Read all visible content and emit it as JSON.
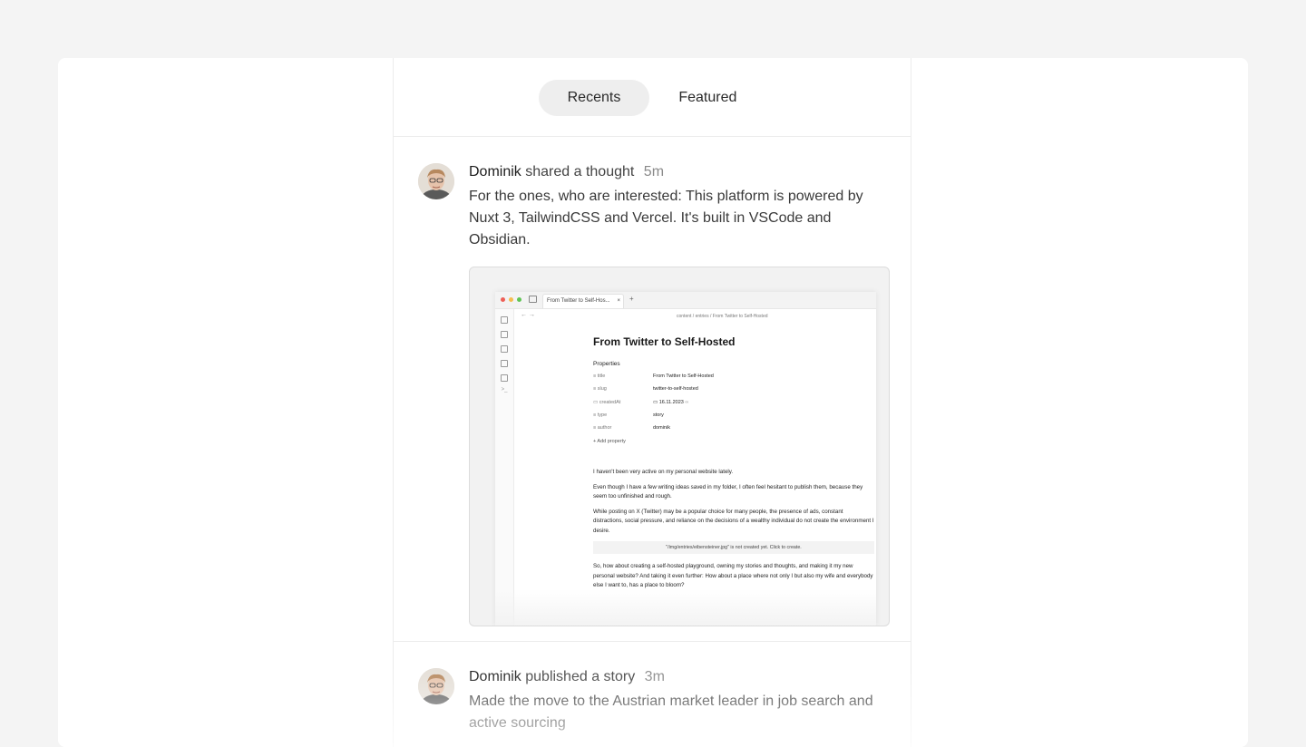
{
  "tabs": {
    "recents": "Recents",
    "featured": "Featured"
  },
  "post1": {
    "author": "Dominik",
    "action": "shared a thought",
    "time": "5m",
    "text": "For the ones, who are interested: This platform is powered by Nuxt 3, TailwindCSS and Vercel. It's built in VSCode and Obsidian.",
    "screenshot": {
      "tab_title": "From Twitter to Self-Hos...",
      "tab_close": "×",
      "tab_add": "+",
      "nav": "←  →",
      "breadcrumb": "content / entries / From Twitter to Self-Hosted",
      "heading": "From Twitter to Self-Hosted",
      "properties_label": "Properties",
      "properties": [
        {
          "key": "title",
          "value": "From Twitter to Self-Hosted"
        },
        {
          "key": "slug",
          "value": "twitter-to-self-hosted"
        },
        {
          "key": "createdAt",
          "value": "16.11.2023"
        },
        {
          "key": "type",
          "value": "story"
        },
        {
          "key": "author",
          "value": "dominik"
        }
      ],
      "add_property": "+ Add property",
      "paragraphs": [
        "I haven't been very active on my personal website lately.",
        "Even though I have a few writing ideas saved in my folder, I often feel hesitant to publish them, because they seem too unfinished and rough.",
        "While posting on X (Twitter) may be a popular choice for many people, the presence of ads, constant distractions, social pressure, and reliance on the decisions of a wealthy individual do not create the environment I desire."
      ],
      "notice": "\"/img/entries/eibensteiner.jpg\" is not created yet. Click to create.",
      "last_paragraph": "So, how about creating a self-hosted playground, owning my stories and thoughts, and making it my new personal website? And taking it even further: How about a place where not only I but also my wife and everybody else I want to, has a place to bloom?"
    }
  },
  "post2": {
    "author": "Dominik",
    "action": "published a story",
    "time": "3m",
    "text": "Made the move to the Austrian market leader in job search and active sourcing"
  },
  "colors": {
    "page_bg": "#f4f4f4",
    "card_bg": "#ffffff",
    "tab_active_bg": "#eeeeee"
  },
  "icons": [
    "avatar-photo",
    "sidebar-file-icon",
    "calendar-icon",
    "link-icon"
  ]
}
